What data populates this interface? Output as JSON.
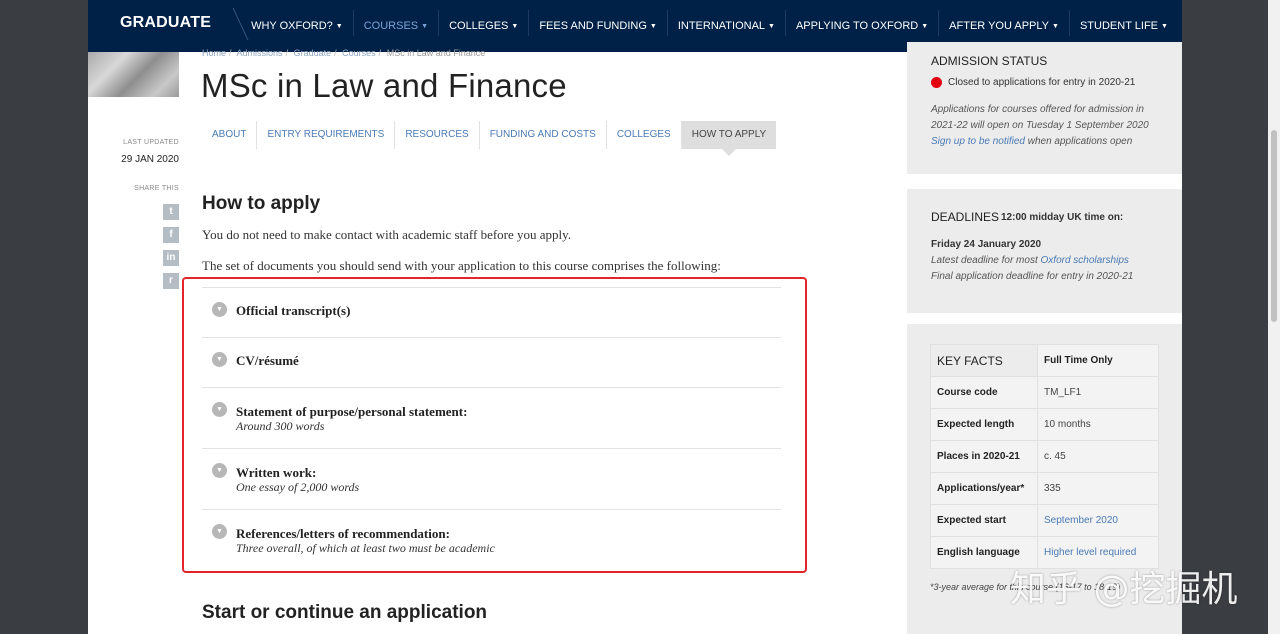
{
  "nav": {
    "brand": "GRADUATE",
    "items": [
      {
        "label": "WHY OXFORD?"
      },
      {
        "label": "COURSES"
      },
      {
        "label": "COLLEGES"
      },
      {
        "label": "FEES AND FUNDING"
      },
      {
        "label": "INTERNATIONAL"
      },
      {
        "label": "APPLYING TO OXFORD"
      },
      {
        "label": "AFTER YOU APPLY"
      },
      {
        "label": "STUDENT LIFE"
      }
    ],
    "active": "COURSES",
    "caret": "▼"
  },
  "breadcrumb": [
    "Home",
    "Admissions",
    "Graduate",
    "Courses",
    "MSc in Law and Finance"
  ],
  "breadcrumb_sep": "/",
  "title": "MSc in Law and Finance",
  "meta": {
    "updated_label": "LAST UPDATED",
    "updated_value": "29 JAN 2020",
    "share_label": "SHARE THIS",
    "share_icons": [
      "twitter-icon",
      "facebook-icon",
      "linkedin-icon",
      "reddit-icon"
    ]
  },
  "tabs": [
    "ABOUT",
    "ENTRY REQUIREMENTS",
    "RESOURCES",
    "FUNDING AND COSTS",
    "COLLEGES",
    "HOW TO APPLY"
  ],
  "active_tab": "HOW TO APPLY",
  "content": {
    "heading": "How to apply",
    "para1": "You do not need to make contact with academic staff before you apply.",
    "para2": "The set of documents you should send with your application to this course comprises the following:",
    "documents": [
      {
        "title": "Official transcript(s)",
        "sub": ""
      },
      {
        "title": "CV/résumé",
        "sub": ""
      },
      {
        "title": "Statement of purpose/personal statement:",
        "sub": "Around 300 words"
      },
      {
        "title": "Written work:",
        "sub": "One essay of 2,000 words"
      },
      {
        "title": "References/letters of recommendation:",
        "sub": "Three overall, of which at least two must be academic"
      }
    ],
    "heading2": "Start or continue an application"
  },
  "admission": {
    "heading": "ADMISSION STATUS",
    "status": "Closed to applications for entry in 2020-21",
    "status_color": "#e3000f",
    "note_line1": "Applications for courses offered for admission in",
    "note_line2": "2021-22 will open on Tuesday 1 September 2020",
    "notify_link": "Sign up to be notified",
    "notify_rest": "when applications open"
  },
  "deadlines": {
    "heading": "DEADLINES",
    "time_note": "12:00 midday UK time on:",
    "date": "Friday 24 January 2020",
    "line1_pre": "Latest deadline for most",
    "line1_link": "Oxford scholarships",
    "line2": "Final application deadline for entry in 2020-21"
  },
  "key_facts": {
    "heading": "KEY FACTS",
    "mode": "Full Time Only",
    "rows": [
      {
        "k": "Course code",
        "v": "TM_LF1"
      },
      {
        "k": "Expected length",
        "v": "10 months"
      },
      {
        "k": "Places in 2020-21",
        "v": "c. 45"
      },
      {
        "k": "Applications/year*",
        "v": "335"
      },
      {
        "k": "Expected start",
        "v": "September 2020"
      },
      {
        "k": "English language",
        "v": "Higher level required"
      }
    ],
    "footnote": "*3-year average for this course (16-17 to 18-19)"
  },
  "watermark": "知乎 @挖掘机"
}
